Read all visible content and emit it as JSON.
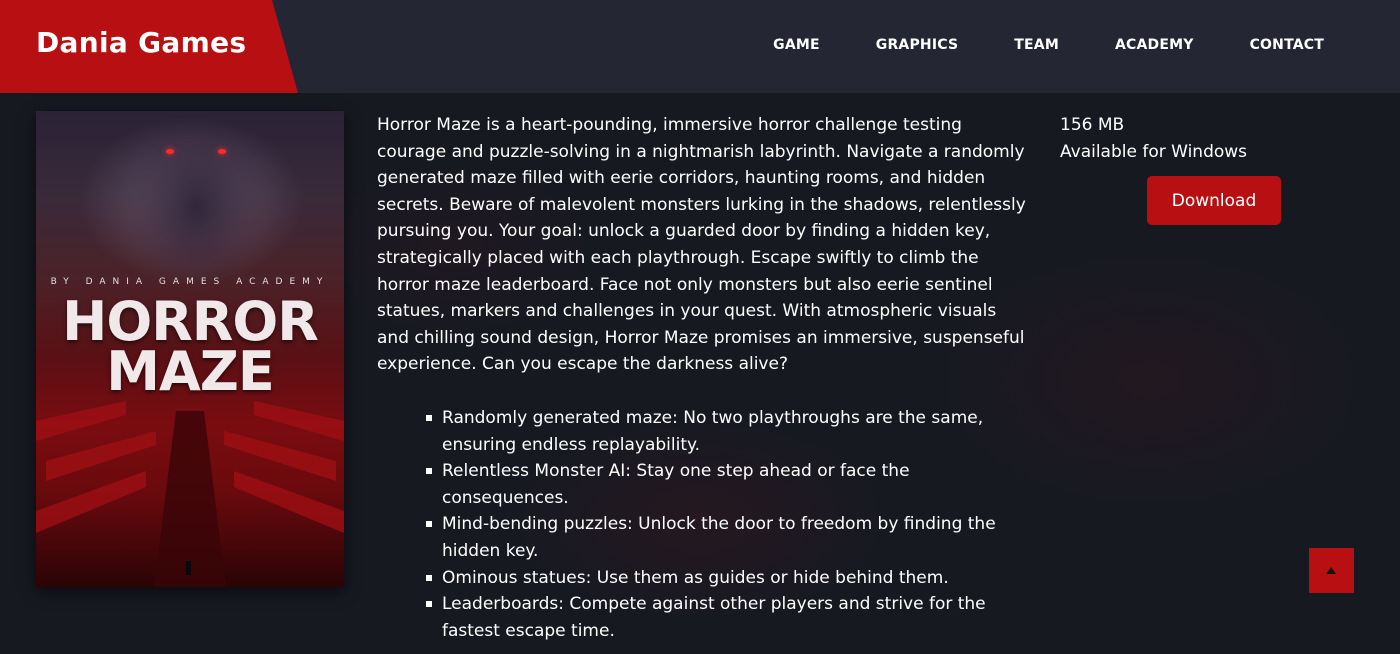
{
  "brand": "Dania Games",
  "nav": {
    "items": [
      {
        "label": "GAME"
      },
      {
        "label": "GRAPHICS"
      },
      {
        "label": "TEAM"
      },
      {
        "label": "ACADEMY"
      },
      {
        "label": "CONTACT"
      }
    ]
  },
  "cover": {
    "byline": "BY DANIA GAMES ACADEMY",
    "title_line1": "HORROR",
    "title_line2": "MAZE"
  },
  "description": "Horror Maze is a heart-pounding, immersive horror challenge testing courage and puzzle-solving in a nightmarish labyrinth. Navigate a randomly generated maze filled with eerie corridors, haunting rooms, and hidden secrets. Beware of malevolent monsters lurking in the shadows, relentlessly pursuing you. Your goal: unlock a guarded door by finding a hidden key, strategically placed with each playthrough. Escape swiftly to climb the horror maze leaderboard. Face not only monsters but also eerie sentinel statues, markers and challenges in your quest. With atmospheric visuals and chilling sound design, Horror Maze promises an immersive, suspenseful experience. Can you escape the darkness alive?",
  "features": [
    "Randomly generated maze: No two playthroughs are the same, ensuring endless replayability.",
    "Relentless Monster AI: Stay one step ahead or face the consequences.",
    "Mind-bending puzzles: Unlock the door to freedom by finding the hidden key.",
    "Ominous statues: Use them as guides or hide behind them.",
    "Leaderboards: Compete against other players and strive for the fastest escape time."
  ],
  "side": {
    "size": "156 MB",
    "platform": "Available for Windows",
    "download_label": "Download"
  },
  "icons": {
    "back_to_top": "caret-up-icon"
  },
  "colors": {
    "accent": "#b80f12",
    "header_bg": "#242634",
    "page_bg": "#171921"
  }
}
